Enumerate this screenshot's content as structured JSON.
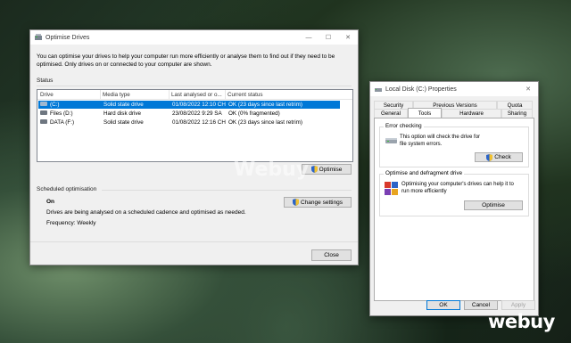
{
  "optimise": {
    "title": "Optimise Drives",
    "intro": "You can optimise your drives to help your computer run more efficiently or analyse them to find out if they need to be optimised. Only drives on or connected to your computer are shown.",
    "status_label": "Status",
    "columns": [
      "Drive",
      "Media type",
      "Last analysed or o...",
      "Current status"
    ],
    "rows": [
      {
        "drive": "(C:)",
        "media": "Solid state drive",
        "last": "01/08/2022 12:10 CH",
        "status": "OK (23 days since last retrim)",
        "selected": true
      },
      {
        "drive": "Files (D:)",
        "media": "Hard disk drive",
        "last": "23/08/2022 9:29 SA",
        "status": "OK (0% fragmented)",
        "selected": false
      },
      {
        "drive": "DATA (F:)",
        "media": "Solid state drive",
        "last": "01/08/2022 12:16 CH",
        "status": "OK (23 days since last retrim)",
        "selected": false
      }
    ],
    "optimise_button": "Optimise",
    "scheduled_label": "Scheduled optimisation",
    "scheduled_state": "On",
    "scheduled_desc": "Drives are being analysed on a scheduled cadence and optimised as needed.",
    "frequency": "Frequency: Weekly",
    "change_settings": "Change settings",
    "close": "Close"
  },
  "properties": {
    "title": "Local Disk (C:) Properties",
    "tabs_row1": [
      "Security",
      "Previous Versions",
      "Quota"
    ],
    "tabs_row2": [
      "General",
      "Tools",
      "Hardware",
      "Sharing"
    ],
    "active_tab": "Tools",
    "error_checking": {
      "label": "Error checking",
      "text": "This option will check the drive for file system errors.",
      "button": "Check"
    },
    "optimise_section": {
      "label": "Optimise and defragment drive",
      "text": "Optimising your computer's drives can help it to run more efficiently",
      "button": "Optimise"
    },
    "ok": "OK",
    "cancel": "Cancel",
    "apply": "Apply"
  },
  "branding": {
    "watermark": "Webuy",
    "logo": "webuy"
  },
  "colors": {
    "selection": "#0078d7",
    "window_bg": "#f0f0f0"
  }
}
